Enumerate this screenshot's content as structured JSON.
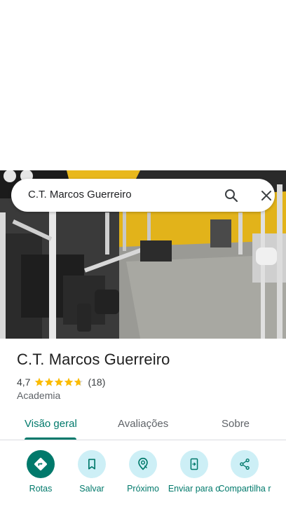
{
  "search": {
    "query": "C.T. Marcos Guerreiro"
  },
  "place": {
    "name": "C.T. Marcos Guerreiro",
    "rating": "4,7",
    "stars": 4.7,
    "review_count": "(18)",
    "category": "Academia"
  },
  "tabs": [
    {
      "label": "Visão geral",
      "active": true
    },
    {
      "label": "Avaliações",
      "active": false
    },
    {
      "label": "Sobre",
      "active": false
    }
  ],
  "actions": [
    {
      "label": "Rotas",
      "icon": "directions-icon"
    },
    {
      "label": "Salvar",
      "icon": "bookmark-icon"
    },
    {
      "label": "Próximo",
      "icon": "nearby-icon"
    },
    {
      "label": "Enviar para o",
      "icon": "send-to-phone-icon"
    },
    {
      "label": "Compartilha r",
      "icon": "share-icon"
    }
  ],
  "colors": {
    "accent": "#00796b",
    "action_bg": "#cdeff6",
    "star": "#fbbc04"
  }
}
